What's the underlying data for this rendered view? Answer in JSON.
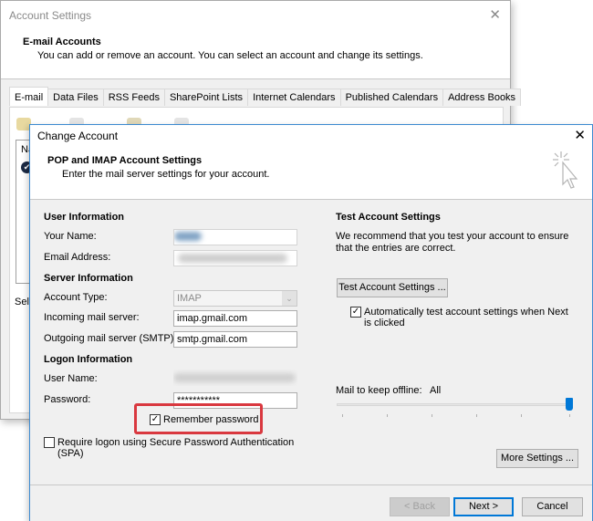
{
  "account_settings": {
    "title": "Account Settings",
    "close_glyph": "✕",
    "header_title": "E-mail Accounts",
    "header_subtitle": "You can add or remove an account. You can select an account and change its settings.",
    "tabs": [
      {
        "label": "E-mail",
        "active": true
      },
      {
        "label": "Data Files",
        "active": false
      },
      {
        "label": "RSS Feeds",
        "active": false
      },
      {
        "label": "SharePoint Lists",
        "active": false
      },
      {
        "label": "Internet Calendars",
        "active": false
      },
      {
        "label": "Published Calendars",
        "active": false
      },
      {
        "label": "Address Books",
        "active": false
      }
    ],
    "list_header_partial": "Na",
    "select_text_partial": "Sele"
  },
  "change_account": {
    "title": "Change Account",
    "close_glyph": "✕",
    "header_title": "POP and IMAP Account Settings",
    "header_subtitle": "Enter the mail server settings for your account.",
    "user_info": {
      "section": "User Information",
      "your_name_label": "Your Name:",
      "your_name_value": "",
      "email_label": "Email Address:",
      "email_value": ""
    },
    "server_info": {
      "section": "Server Information",
      "account_type_label": "Account Type:",
      "account_type_value": "IMAP",
      "incoming_label": "Incoming mail server:",
      "incoming_value": "imap.gmail.com",
      "outgoing_label": "Outgoing mail server (SMTP):",
      "outgoing_value": "smtp.gmail.com"
    },
    "logon_info": {
      "section": "Logon Information",
      "username_label": "User Name:",
      "username_value": "",
      "password_label": "Password:",
      "password_value": "***********",
      "remember_password_label": "Remember password",
      "remember_password_checked": true,
      "spa_label_line1": "Require logon using Secure Password Authentication",
      "spa_label_line2": "(SPA)",
      "spa_checked": false
    },
    "test_settings": {
      "section": "Test Account Settings",
      "description": "We recommend that you test your account to ensure that the entries are correct.",
      "test_button": "Test Account Settings ...",
      "auto_test_label": "Automatically test account settings when Next is clicked",
      "auto_test_checked": true
    },
    "offline": {
      "label": "Mail to keep offline:",
      "value": "All",
      "slider_position_fraction": 1.0,
      "tick_count": 6
    },
    "more_settings_button": "More Settings ...",
    "footer": {
      "back_button": "< Back",
      "next_button": "Next >",
      "cancel_button": "Cancel"
    },
    "highlight_color": "#d9383f",
    "accent_color": "#0078d7"
  }
}
